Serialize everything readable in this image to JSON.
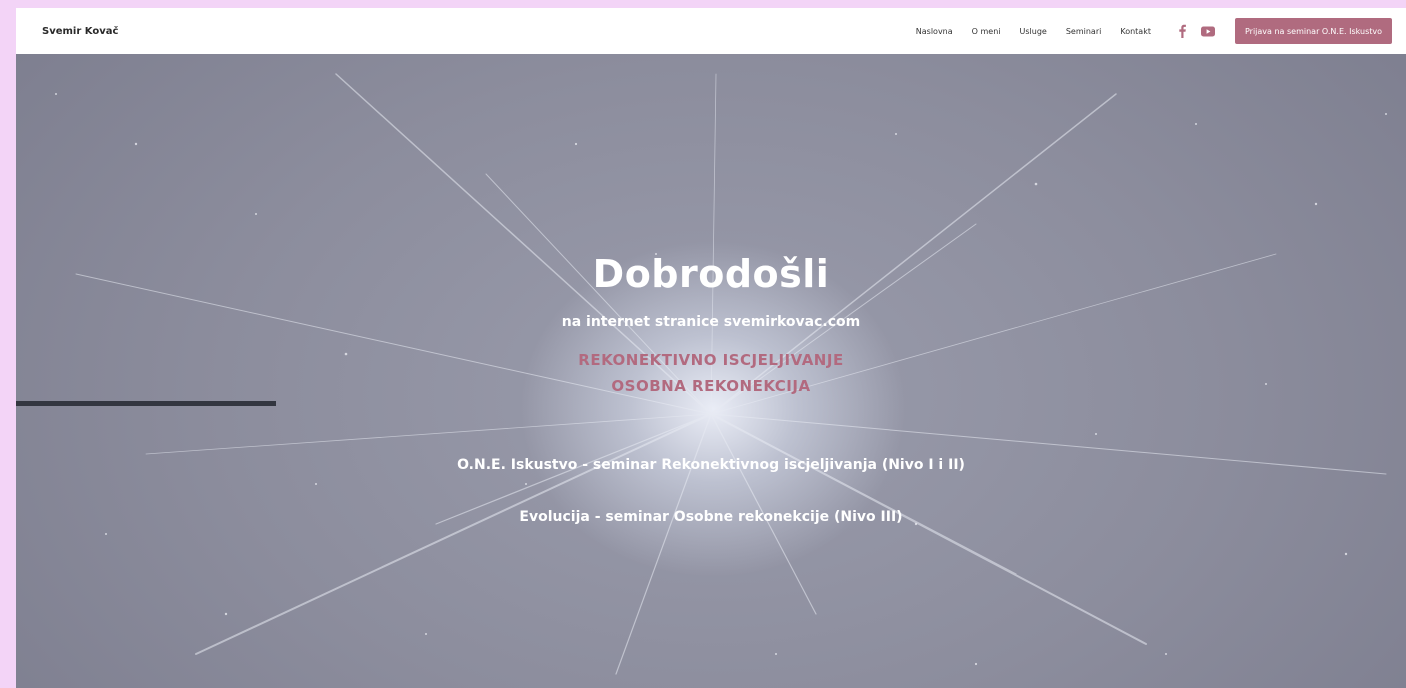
{
  "header": {
    "brand": "Svemir Kovač",
    "nav": [
      "Naslovna",
      "O meni",
      "Usluge",
      "Seminari",
      "Kontakt"
    ],
    "social": [
      "facebook-icon",
      "youtube-icon"
    ],
    "cta_label": "Prijava na seminar O.N.E. Iskustvo"
  },
  "hero": {
    "title": "Dobrodošli",
    "subtitle": "na internet stranice svemirkovac.com",
    "accent_line_1": "REKONEKTIVNO ISCJELJIVANJE",
    "accent_line_2": "OSOBNA REKONEKCIJA",
    "seminar_1": "O.N.E. Iskustvo - seminar Rekonektivnog iscjeljivanja (Nivo I i II)",
    "seminar_2": "Evolucija - seminar Osobne rekonekcije (Nivo III)"
  },
  "colors": {
    "accent": "#b06b7f",
    "page_background": "#f3d4f7"
  }
}
